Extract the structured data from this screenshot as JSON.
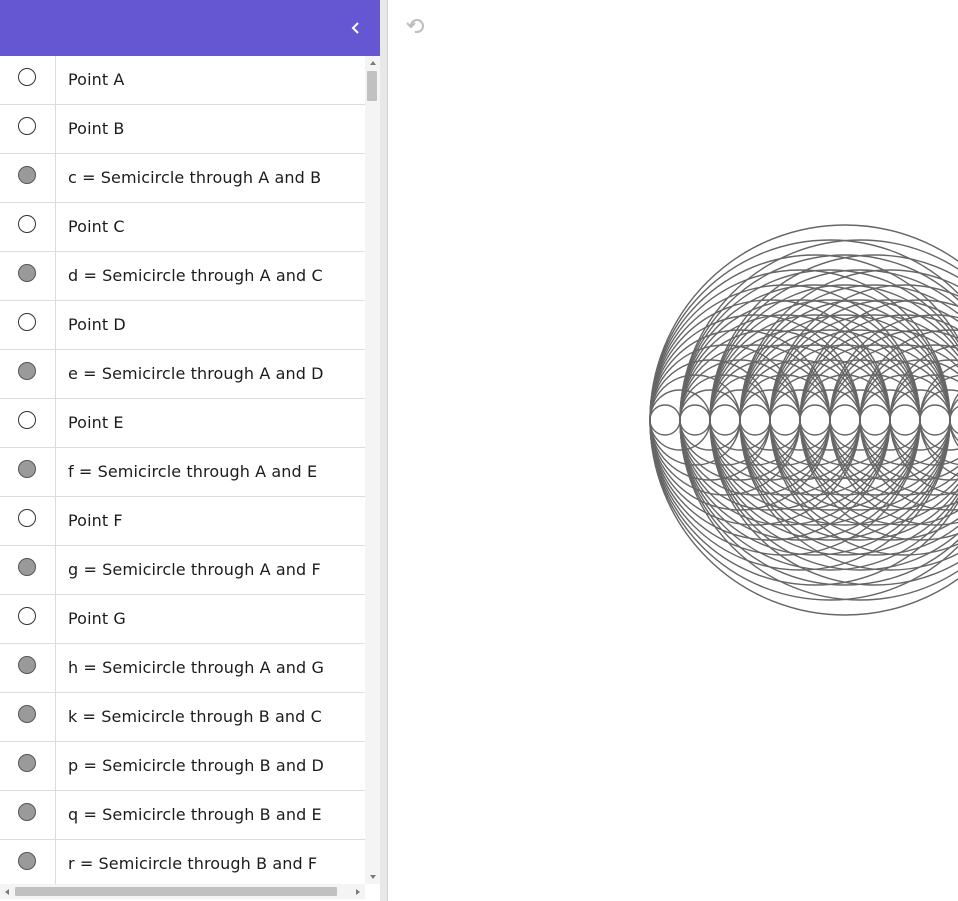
{
  "algebra_view": {
    "header_color": "#6557d2",
    "collapse_icon": "chevron-left-icon",
    "rows": [
      {
        "label": "Point A",
        "marble": "empty"
      },
      {
        "label": "Point B",
        "marble": "empty"
      },
      {
        "label": "c = Semicircle through A and B",
        "marble": "filled"
      },
      {
        "label": "Point C",
        "marble": "empty"
      },
      {
        "label": "d = Semicircle through A and C",
        "marble": "filled"
      },
      {
        "label": "Point D",
        "marble": "empty"
      },
      {
        "label": "e = Semicircle through A and D",
        "marble": "filled"
      },
      {
        "label": "Point E",
        "marble": "empty"
      },
      {
        "label": "f = Semicircle through A and E",
        "marble": "filled"
      },
      {
        "label": "Point F",
        "marble": "empty"
      },
      {
        "label": "g = Semicircle through A and F",
        "marble": "filled"
      },
      {
        "label": "Point G",
        "marble": "empty"
      },
      {
        "label": "h = Semicircle through A and G",
        "marble": "filled"
      },
      {
        "label": "k = Semicircle through B and C",
        "marble": "filled"
      },
      {
        "label": "p = Semicircle through B and D",
        "marble": "filled"
      },
      {
        "label": "q = Semicircle through B and E",
        "marble": "filled"
      },
      {
        "label": "r = Semicircle through B and F",
        "marble": "filled"
      }
    ]
  },
  "graphics_view": {
    "undo_icon": "undo-icon",
    "stroke_color": "#666666"
  }
}
